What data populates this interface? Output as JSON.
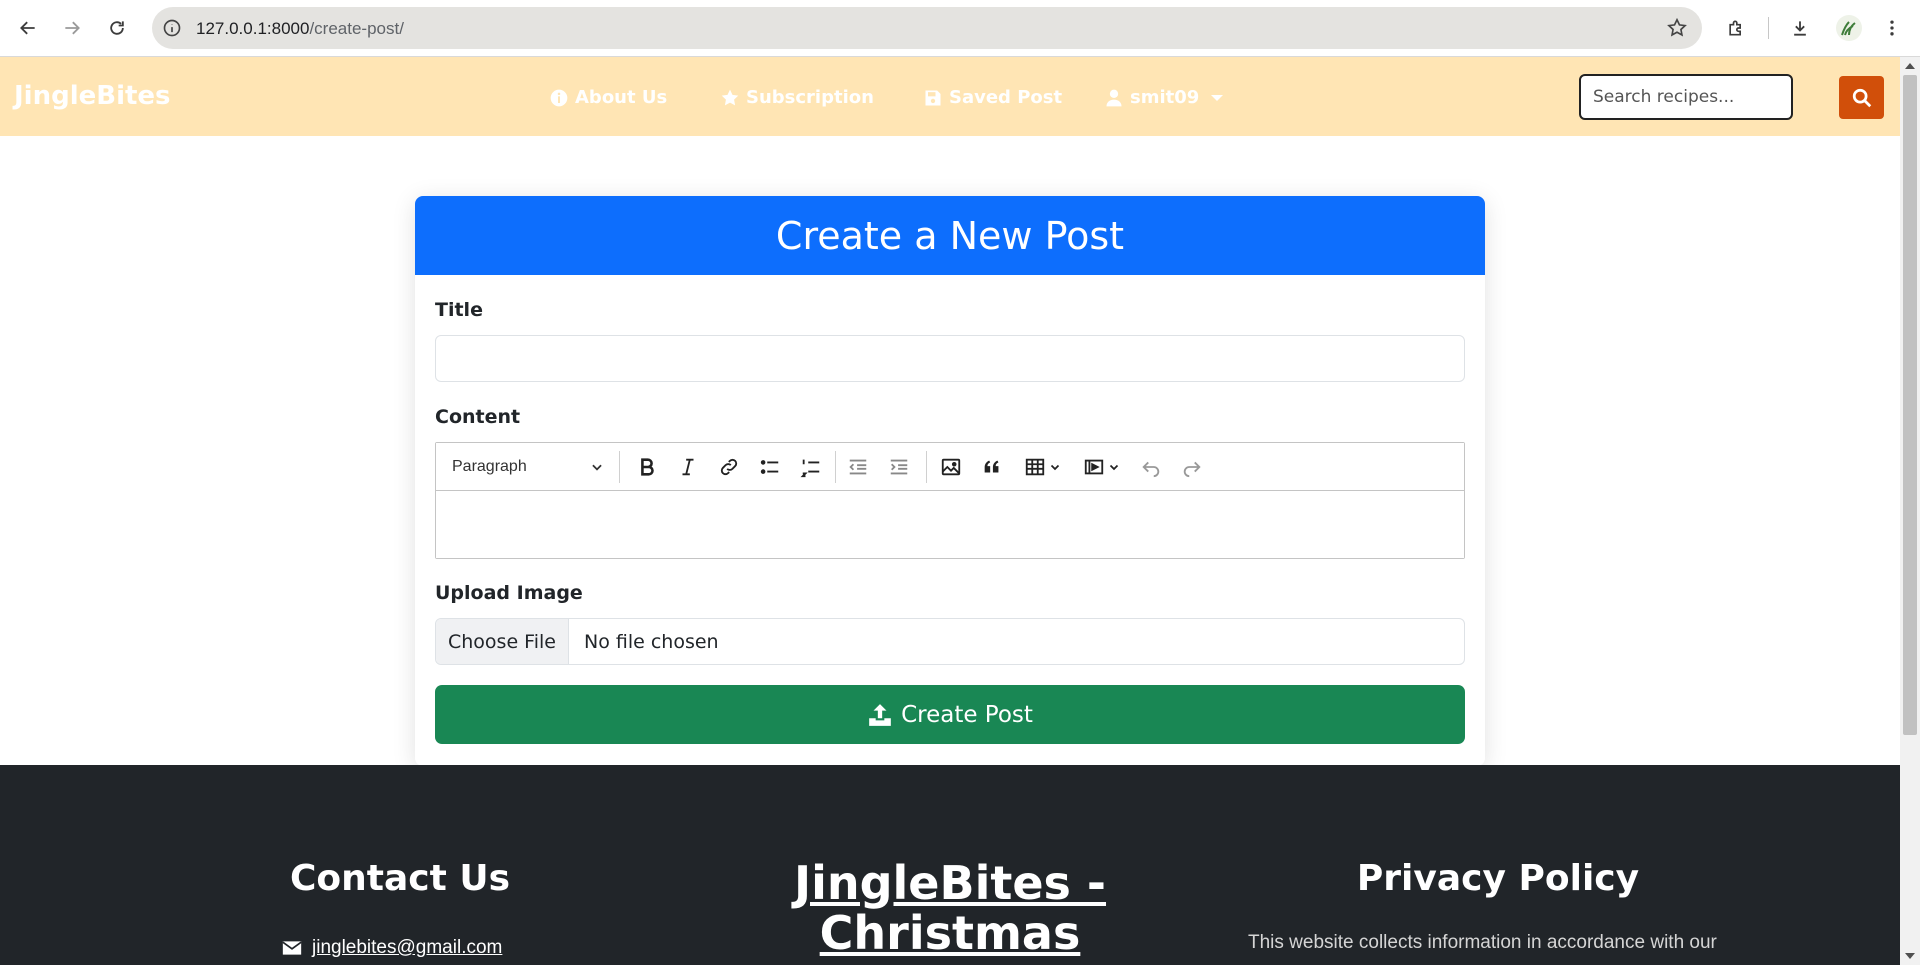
{
  "browser": {
    "url_host": "127.0.0.1:8000",
    "url_path": "/create-post/"
  },
  "navbar": {
    "brand": "JingleBites",
    "links": [
      {
        "label": "About Us",
        "icon": "info-circle-icon"
      },
      {
        "label": "Subscription",
        "icon": "star-icon"
      },
      {
        "label": "Saved Post",
        "icon": "save-icon"
      },
      {
        "label": "smit09",
        "icon": "user-icon"
      }
    ],
    "search_placeholder": "Search recipes...",
    "colors": {
      "background": "#ffe5b4",
      "search_button": "#d14f0a"
    }
  },
  "form": {
    "header": "Create a New Post",
    "title_label": "Title",
    "title_value": "",
    "content_label": "Content",
    "editor": {
      "block_format": "Paragraph",
      "tools": [
        "bold-icon",
        "italic-icon",
        "link-icon",
        "bulleted-list-icon",
        "numbered-list-icon",
        "outdent-icon",
        "indent-icon",
        "image-icon",
        "blockquote-icon",
        "table-icon",
        "media-icon",
        "undo-icon",
        "redo-icon"
      ]
    },
    "upload_label": "Upload Image",
    "file_button": "Choose File",
    "file_status": "No file chosen",
    "submit_label": "Create Post",
    "colors": {
      "header": "#0d6efd",
      "submit": "#198754"
    }
  },
  "footer": {
    "contact_heading": "Contact Us",
    "email": "jinglebites@gmail.com",
    "brand_title": "JingleBites - Christmas Treats",
    "privacy_heading": "Privacy Policy",
    "privacy_text": "This website collects information in accordance with our"
  }
}
